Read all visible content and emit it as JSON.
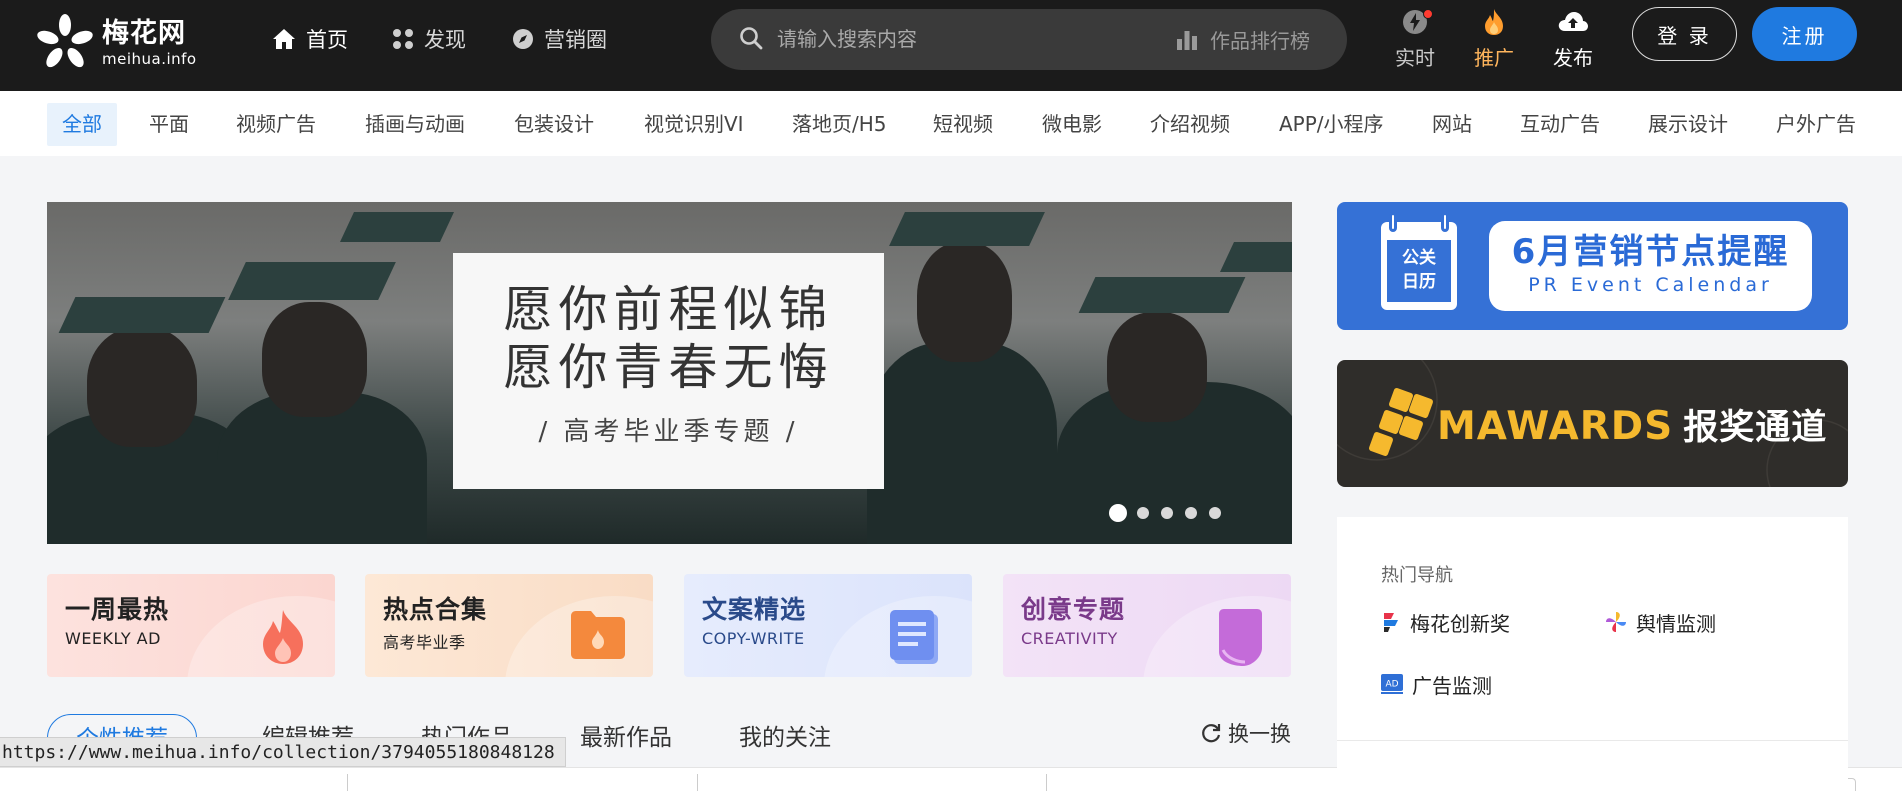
{
  "header": {
    "logo": {
      "cn": "梅花网",
      "en": "meihua.info"
    },
    "nav": [
      {
        "label": "首页",
        "icon": "home-icon"
      },
      {
        "label": "发现",
        "icon": "grid-dots-icon"
      },
      {
        "label": "营销圈",
        "icon": "compass-icon"
      }
    ],
    "search": {
      "placeholder": "请输入搜索内容",
      "rank_label": "作品排行榜"
    },
    "tools": [
      {
        "label": "实时",
        "icon": "lightning-icon"
      },
      {
        "label": "推广",
        "icon": "flame-icon"
      },
      {
        "label": "发布",
        "icon": "cloud-upload-icon"
      }
    ],
    "login_label": "登 录",
    "register_label": "注册"
  },
  "categories": [
    "全部",
    "平面",
    "视频广告",
    "插画与动画",
    "包装设计",
    "视觉识别VI",
    "落地页/H5",
    "短视频",
    "微电影",
    "介绍视频",
    "APP/小程序",
    "网站",
    "互动广告",
    "展示设计",
    "户外广告"
  ],
  "banner": {
    "line1": "愿你前程似锦",
    "line2": "愿你青春无悔",
    "subtitle": "/  高考毕业季专题  /",
    "slide_count": 5,
    "active_slide": 1
  },
  "feature_cards": [
    {
      "title": "一周最热",
      "subtitle": "WEEKLY AD",
      "icon": "flame-icon"
    },
    {
      "title": "热点合集",
      "subtitle": "高考毕业季",
      "icon": "folder-icon"
    },
    {
      "title": "文案精选",
      "subtitle": "COPY-WRITE",
      "icon": "document-icon"
    },
    {
      "title": "创意专题",
      "subtitle": "CREATIVITY",
      "icon": "tag-icon"
    }
  ],
  "tabs": [
    "个性推荐",
    "编辑推荐",
    "热门作品",
    "最新作品",
    "我的关注"
  ],
  "refresh_label": "换一换",
  "status_url": "https://www.meihua.info/collection/3794055180848128",
  "sidebar": {
    "promo_calendar": {
      "badge_l1": "公关",
      "badge_l2": "日历",
      "title": "6月营销节点提醒",
      "subtitle": "PR Event Calendar"
    },
    "promo_mawards": {
      "brand": "MAWARDS",
      "cta": "报奖通道"
    },
    "hot_nav": {
      "title": "热门导航",
      "items": [
        {
          "label": "梅花创新奖",
          "icon": "meihua-award-icon"
        },
        {
          "label": "舆情监测",
          "icon": "pinwheel-icon"
        },
        {
          "label": "广告监测",
          "icon": "ad-icon"
        }
      ]
    }
  },
  "colors": {
    "accent": "#1f7ae0",
    "topbar": "#1b1b1b",
    "promote": "#ffb55c",
    "mawards_gold": "#f5b92e",
    "calendar_blue": "#3571d6"
  }
}
